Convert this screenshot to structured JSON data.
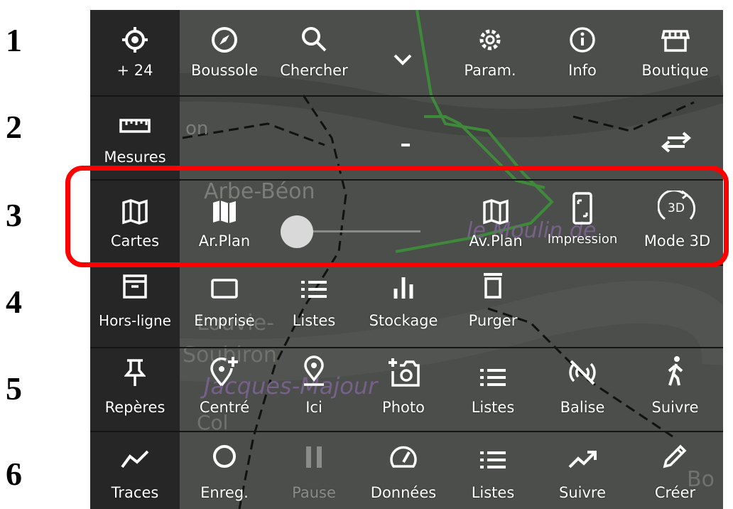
{
  "row_numbers": [
    "1",
    "2",
    "3",
    "4",
    "5",
    "6"
  ],
  "rows": {
    "r1": {
      "gps_label": "+ 24",
      "compass_label": "Boussole",
      "search_label": "Chercher",
      "settings_label": "Param.",
      "info_label": "Info",
      "shop_label": "Boutique",
      "expand_icon": "chevron-down-icon"
    },
    "r2": {
      "measure_label": "Mesures",
      "mode_value": "-"
    },
    "r3": {
      "maps_label": "Cartes",
      "back_label": "Ar.Plan",
      "front_label": "Av.Plan",
      "print_label": "Impression",
      "mode3d_label": "Mode 3D",
      "mode3d_icon_text": "3D",
      "slider_value": 0
    },
    "r4": {
      "offline_label": "Hors-ligne",
      "extent_label": "Emprise",
      "lists_label": "Listes",
      "storage_label": "Stockage",
      "purge_label": "Purger"
    },
    "r5": {
      "markers_label": "Repères",
      "center_label": "Centré",
      "here_label": "Ici",
      "photo_label": "Photo",
      "lists_label": "Listes",
      "beacon_label": "Balise",
      "follow_label": "Suivre"
    },
    "r6": {
      "tracks_label": "Traces",
      "record_label": "Enreg.",
      "pause_label": "Pause",
      "data_label": "Données",
      "lists_label": "Listes",
      "follow_label": "Suivre",
      "create_label": "Créer"
    }
  },
  "map_labels": [
    "on",
    "Arbe-Béon",
    "Louvie-",
    "Soubiron",
    "le Moulin de",
    "Jacques-Majour",
    "Col",
    "Bo"
  ],
  "colors": {
    "highlight": "#ff0000",
    "panel_dark": "#262626",
    "track": "#3f8a3a"
  }
}
